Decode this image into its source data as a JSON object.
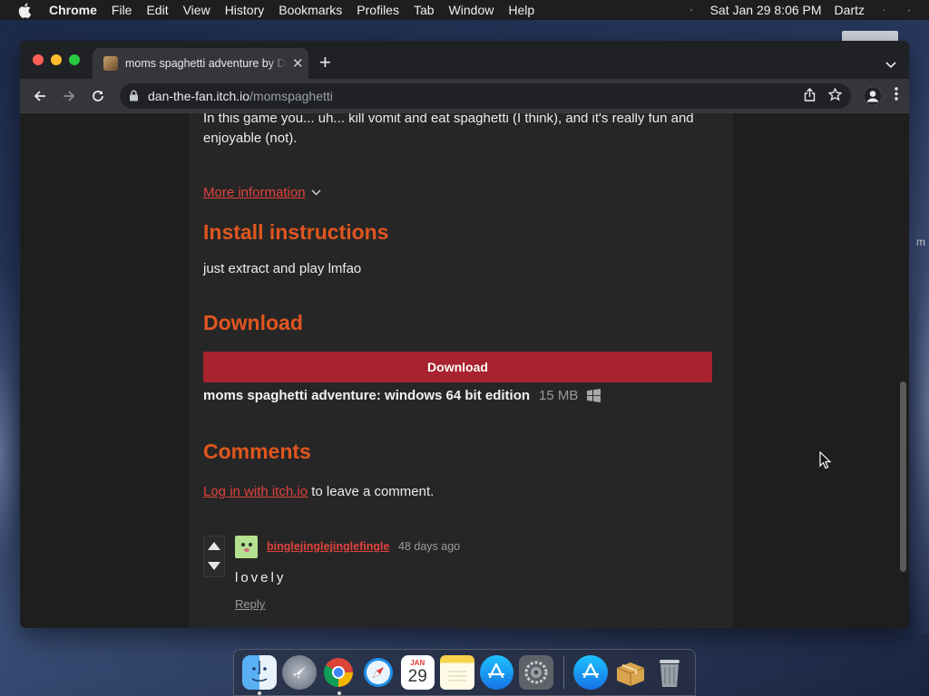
{
  "menubar": {
    "app": "Chrome",
    "items": [
      "File",
      "Edit",
      "View",
      "History",
      "Bookmarks",
      "Profiles",
      "Tab",
      "Window",
      "Help"
    ],
    "datetime": "Sat Jan 29  8:06 PM",
    "user": "Dartz"
  },
  "browser": {
    "tab_title": "moms spaghetti adventure by Dartz",
    "url_host": "dan-the-fan.itch.io",
    "url_path": "/momspaghetti"
  },
  "page": {
    "description": "In this game you... uh... kill vomit and eat spaghetti (I think), and it's really fun and enjoyable (not).",
    "more_info": "More information",
    "install_heading": "Install instructions",
    "install_text": "just extract and play lmfao",
    "download_heading": "Download",
    "download_button": "Download",
    "file_name": "moms spaghetti adventure: windows 64 bit edition",
    "file_size": "15 MB",
    "comments_heading": "Comments",
    "login_link": "Log in with itch.io",
    "login_suffix": " to leave a comment."
  },
  "comment": {
    "user": "binglejinglejinglefingle",
    "time": "48 days ago",
    "body": "lovely",
    "reply": "Reply"
  },
  "desktop": {
    "side_label": "m"
  },
  "dock": {
    "calendar_month": "JAN",
    "calendar_day": "29"
  },
  "colors": {
    "accent_heading": "#e0561f",
    "link": "#e0423d",
    "download_button": "#a8232f"
  }
}
